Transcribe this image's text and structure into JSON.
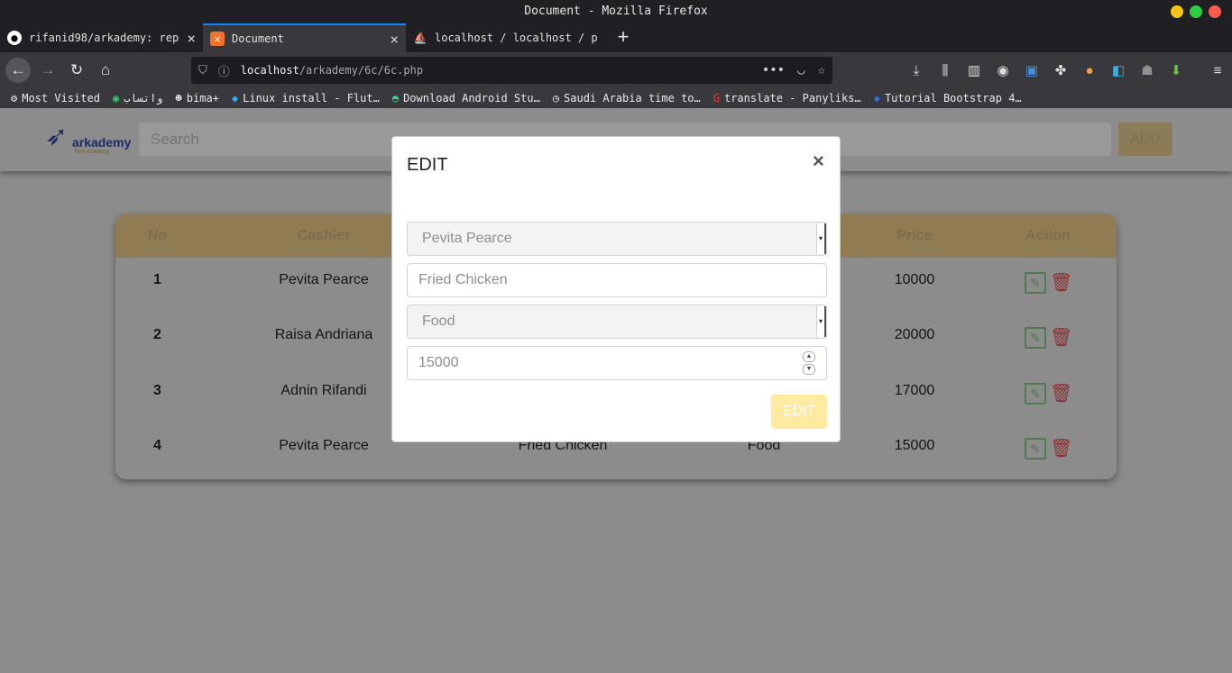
{
  "window": {
    "title": "Document - Mozilla Firefox"
  },
  "tabs": [
    {
      "label": "rifanid98/arkademy: repos",
      "icon": "github-icon",
      "active": false
    },
    {
      "label": "Document",
      "icon": "xampp-icon",
      "active": true
    },
    {
      "label": "localhost / localhost / p",
      "icon": "phpmyadmin-icon",
      "active": false
    }
  ],
  "address": {
    "host": "localhost",
    "path": "/arkademy/6c/6c.php"
  },
  "bookmarks": [
    {
      "label": "Most Visited",
      "icon": "gear-icon"
    },
    {
      "label": "واتساب",
      "icon": "whatsapp-icon"
    },
    {
      "label": "bima+",
      "icon": "bima-icon"
    },
    {
      "label": "Linux install - Flut…",
      "icon": "flutter-icon"
    },
    {
      "label": "Download Android Stu…",
      "icon": "android-icon"
    },
    {
      "label": "Saudi Arabia time to…",
      "icon": "clock-icon"
    },
    {
      "label": "translate - Panyliks…",
      "icon": "google-icon"
    },
    {
      "label": "Tutorial Bootstrap 4…",
      "icon": "bootstrap-icon"
    }
  ],
  "app": {
    "logo_name": "arkademy",
    "logo_tagline": "Tech Academy",
    "search_placeholder": "Search",
    "add_label": "ADD"
  },
  "table": {
    "headers": {
      "no": "No",
      "cashier": "Cashier",
      "price": "Price",
      "action": "Action"
    },
    "rows": [
      {
        "no": "1",
        "cashier": "Pevita Pearce",
        "product": "",
        "category": "",
        "price": "10000"
      },
      {
        "no": "2",
        "cashier": "Raisa Andriana",
        "product": "",
        "category": "",
        "price": "20000"
      },
      {
        "no": "3",
        "cashier": "Adnin Rifandi",
        "product": "",
        "category": "",
        "price": "17000"
      },
      {
        "no": "4",
        "cashier": "Pevita Pearce",
        "product": "Fried Chicken",
        "category": "Food",
        "price": "15000"
      }
    ]
  },
  "modal": {
    "title": "EDIT",
    "close": "×",
    "cashier_value": "Pevita Pearce",
    "product_value": "Fried Chicken",
    "category_value": "Food",
    "price_value": "15000",
    "submit_label": "EDIT"
  },
  "colors": {
    "accent": "#ffd86e",
    "edit_icon": "#4caf50",
    "delete_icon": "#e53935",
    "firefox_blue": "#0a84ff"
  }
}
